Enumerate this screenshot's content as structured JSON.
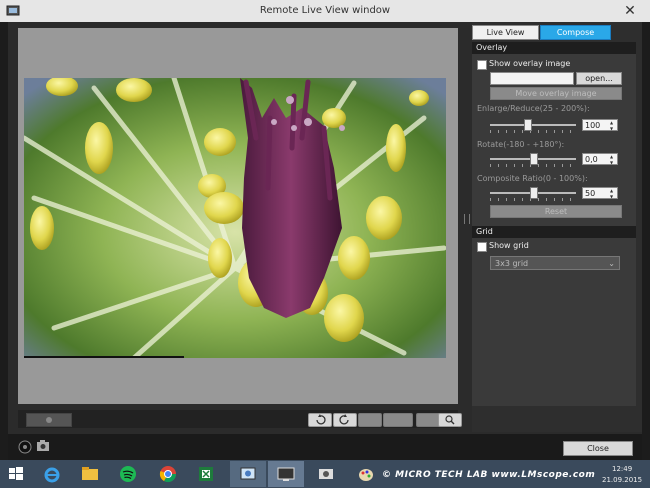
{
  "window": {
    "title": "Remote Live View window"
  },
  "tabs": [
    {
      "label": "Live View",
      "active": false
    },
    {
      "label": "Compose",
      "active": true
    }
  ],
  "overlay": {
    "header": "Overlay",
    "show_overlay_label": "Show overlay image",
    "show_overlay_checked": false,
    "open_label": "open...",
    "move_label": "Move overlay image",
    "enlarge_label": "Enlarge/Reduce(25 - 200%):",
    "enlarge_value": "100",
    "rotate_label": "Rotate(-180 - +180°):",
    "rotate_value": "0,0",
    "ratio_label": "Composite Ratio(0 - 100%):",
    "ratio_value": "50",
    "reset_label": "Reset"
  },
  "grid": {
    "header": "Grid",
    "show_grid_label": "Show grid",
    "show_grid_checked": false,
    "grid_type": "3x3 grid"
  },
  "footer": {
    "close_label": "Close"
  },
  "taskbar": {
    "time": "12:49",
    "date": "21.09.2015"
  },
  "watermark": {
    "text": "© MICRO TECH LAB   www.LMscope.com"
  },
  "colors": {
    "accent": "#2aa8e8",
    "window_bg": "#2b2b2b",
    "panel_bg": "#3a3a3a"
  },
  "icons": [
    "windows-start-icon",
    "ie-icon",
    "explorer-icon",
    "spotify-icon",
    "chrome-icon",
    "excel-icon",
    "eos-utility-icon",
    "remote-app-icon",
    "camera-icon",
    "paint-icon"
  ]
}
